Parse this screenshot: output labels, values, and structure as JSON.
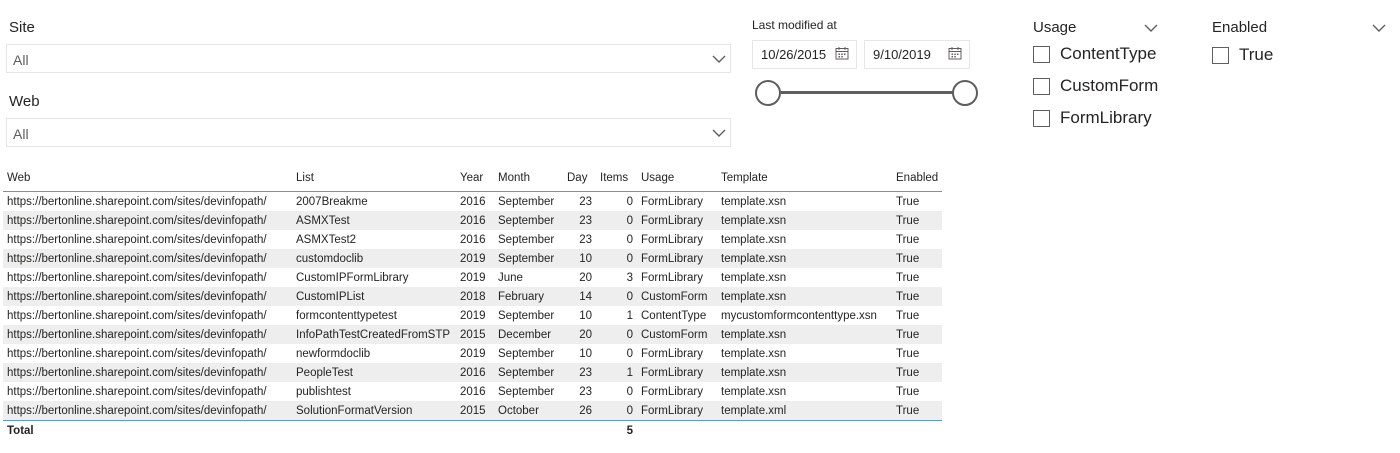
{
  "site_slicer": {
    "title": "Site",
    "value": "All"
  },
  "web_slicer": {
    "title": "Web",
    "value": "All"
  },
  "date_slicer": {
    "title": "Last modified at",
    "start": "10/26/2015",
    "end": "9/10/2019"
  },
  "usage_slicer": {
    "title": "Usage",
    "options": [
      "ContentType",
      "CustomForm",
      "FormLibrary"
    ]
  },
  "enabled_slicer": {
    "title": "Enabled",
    "options": [
      "True"
    ]
  },
  "table": {
    "headers": [
      "Web",
      "List",
      "Year",
      "Month",
      "Day",
      "Items",
      "Usage",
      "Template",
      "Enabled"
    ],
    "rows": [
      [
        "https://bertonline.sharepoint.com/sites/devinfopath/",
        "2007Breakme",
        "2016",
        "September",
        "23",
        "0",
        "FormLibrary",
        "template.xsn",
        "True"
      ],
      [
        "https://bertonline.sharepoint.com/sites/devinfopath/",
        "ASMXTest",
        "2016",
        "September",
        "23",
        "0",
        "FormLibrary",
        "template.xsn",
        "True"
      ],
      [
        "https://bertonline.sharepoint.com/sites/devinfopath/",
        "ASMXTest2",
        "2016",
        "September",
        "23",
        "0",
        "FormLibrary",
        "template.xsn",
        "True"
      ],
      [
        "https://bertonline.sharepoint.com/sites/devinfopath/",
        "customdoclib",
        "2019",
        "September",
        "10",
        "0",
        "FormLibrary",
        "template.xsn",
        "True"
      ],
      [
        "https://bertonline.sharepoint.com/sites/devinfopath/",
        "CustomIPFormLibrary",
        "2019",
        "June",
        "20",
        "3",
        "FormLibrary",
        "template.xsn",
        "True"
      ],
      [
        "https://bertonline.sharepoint.com/sites/devinfopath/",
        "CustomIPList",
        "2018",
        "February",
        "14",
        "0",
        "CustomForm",
        "template.xsn",
        "True"
      ],
      [
        "https://bertonline.sharepoint.com/sites/devinfopath/",
        "formcontenttypetest",
        "2019",
        "September",
        "10",
        "1",
        "ContentType",
        "mycustomformcontenttype.xsn",
        "True"
      ],
      [
        "https://bertonline.sharepoint.com/sites/devinfopath/",
        "InfoPathTestCreatedFromSTP",
        "2015",
        "December",
        "20",
        "0",
        "CustomForm",
        "template.xsn",
        "True"
      ],
      [
        "https://bertonline.sharepoint.com/sites/devinfopath/",
        "newformdoclib",
        "2019",
        "September",
        "10",
        "0",
        "FormLibrary",
        "template.xsn",
        "True"
      ],
      [
        "https://bertonline.sharepoint.com/sites/devinfopath/",
        "PeopleTest",
        "2016",
        "September",
        "23",
        "1",
        "FormLibrary",
        "template.xsn",
        "True"
      ],
      [
        "https://bertonline.sharepoint.com/sites/devinfopath/",
        "publishtest",
        "2016",
        "September",
        "23",
        "0",
        "FormLibrary",
        "template.xsn",
        "True"
      ],
      [
        "https://bertonline.sharepoint.com/sites/devinfopath/",
        "SolutionFormatVersion",
        "2015",
        "October",
        "26",
        "0",
        "FormLibrary",
        "template.xml",
        "True"
      ]
    ],
    "total_label": "Total",
    "total_items": "5"
  },
  "colors": {
    "accent_line": "#5b9bd5",
    "zebra": "#eeeeee",
    "text": "#252423",
    "border": "#e6e6e6"
  },
  "icons": [
    "chevron-down-icon",
    "calendar-icon",
    "checkbox-icon"
  ]
}
